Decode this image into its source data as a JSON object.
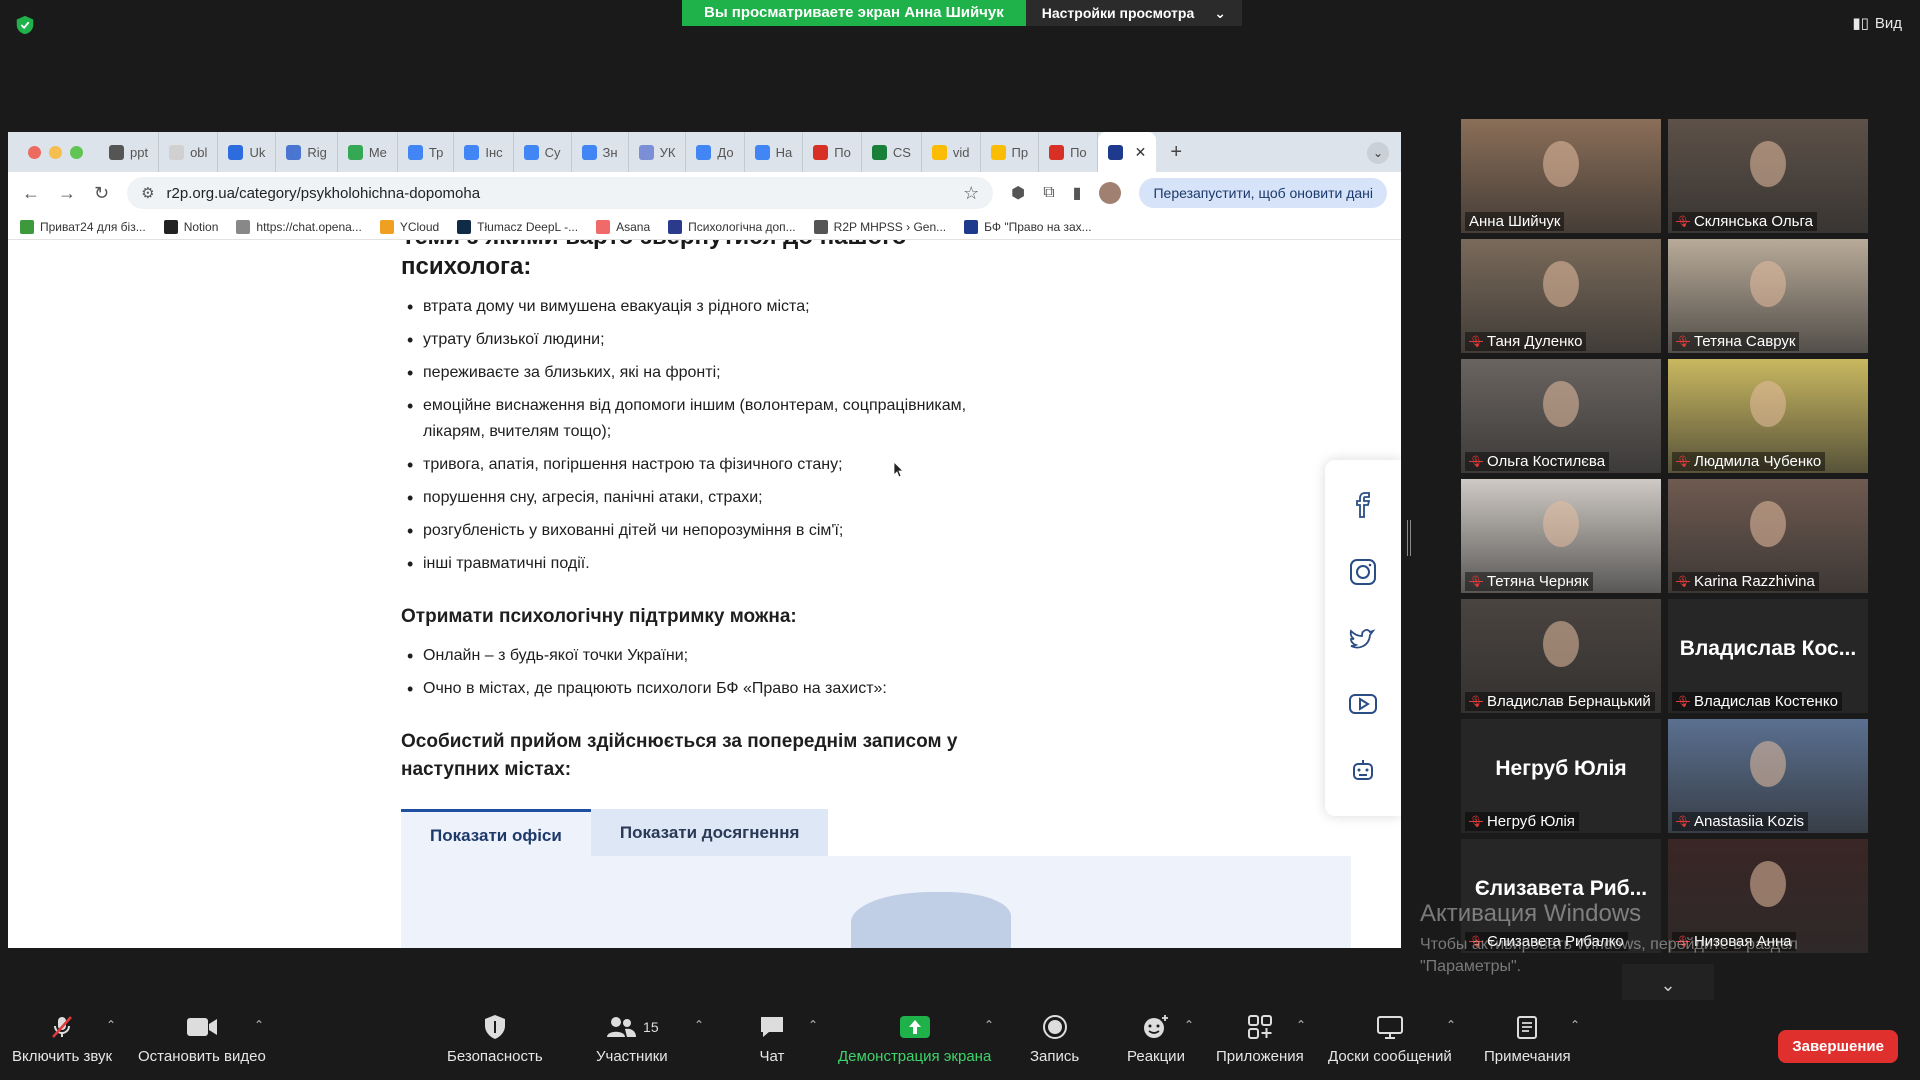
{
  "topbar": {
    "banner_text": "Вы просматриваете экран Анна Шийчук",
    "settings_label": "Настройки просмотра",
    "view_label": "Вид"
  },
  "browser": {
    "tabs": [
      {
        "label": "ppt",
        "color": "#555555"
      },
      {
        "label": "obl",
        "color": "#d0d0d0"
      },
      {
        "label": "Uk",
        "color": "#2d6cdf"
      },
      {
        "label": "Rig",
        "color": "#4a76d1"
      },
      {
        "label": "Me",
        "color": "#34a853"
      },
      {
        "label": "Тр",
        "color": "#4285f4"
      },
      {
        "label": "Інс",
        "color": "#4285f4"
      },
      {
        "label": "Су",
        "color": "#4285f4"
      },
      {
        "label": "Зн",
        "color": "#4285f4"
      },
      {
        "label": "УК",
        "color": "#7a8fd6"
      },
      {
        "label": "До",
        "color": "#4285f4"
      },
      {
        "label": "На",
        "color": "#4285f4"
      },
      {
        "label": "По",
        "color": "#d93025"
      },
      {
        "label": "CS",
        "color": "#188038"
      },
      {
        "label": "vid",
        "color": "#fbbc04"
      },
      {
        "label": "Пр",
        "color": "#fbbc04"
      },
      {
        "label": "По",
        "color": "#d93025"
      }
    ],
    "url": "r2p.org.ua/category/psykholohichna-dopomoha",
    "relaunch": "Перезапустити, щоб оновити дані",
    "bookmarks": [
      {
        "label": "Приват24 для біз...",
        "color": "#3c9a3c"
      },
      {
        "label": "Notion",
        "color": "#222222"
      },
      {
        "label": "https://chat.opena...",
        "color": "#888888"
      },
      {
        "label": "YCloud",
        "color": "#f0a020"
      },
      {
        "label": "Tłumacz DeepL -...",
        "color": "#0f2b46"
      },
      {
        "label": "Asana",
        "color": "#f06a6a"
      },
      {
        "label": "Психологічна доп...",
        "color": "#2b3a8c"
      },
      {
        "label": "R2P MHPSS › Gen...",
        "color": "#555555"
      },
      {
        "label": "БФ \"Право на зах...",
        "color": "#1e3a8c"
      }
    ]
  },
  "page": {
    "heading": "Теми з якими варто звернутися до нашого психолога:",
    "topics": [
      "втрата дому чи вимушена евакуація з рідного міста;",
      "утрату близької людини;",
      "переживаєте за близьких, які на фронті;",
      "емоційне виснаження від допомоги іншим (волонтерам, соцпрацівникам, лікарям, вчителям тощо);",
      "тривога, апатія, погіршення настрою та фізичного стану;",
      "порушення сну, агресія, панічні атаки, страхи;",
      "розгубленість у вихованні дітей чи непорозуміння в сім'ї;",
      "інші травматичні події."
    ],
    "support_heading": "Отримати психологічну підтримку можна:",
    "support": [
      "Онлайн – з будь-якої точки України;",
      "Очно в містах, де працюють психологи БФ «Право на захист»:"
    ],
    "appointment_heading": "Особистий прийом здійснюється за попереднім записом у наступних містах:",
    "tab_offices": "Показати офіси",
    "tab_achievements": "Показати досягнення"
  },
  "participants": [
    {
      "name": "Анна Шийчук",
      "muted": false,
      "speaking": true,
      "photo": "#8a6e58"
    },
    {
      "name": "Склянська Ольга",
      "muted": true,
      "photo": "#5d5148"
    },
    {
      "name": "Таня Дуленко",
      "muted": true,
      "photo": "#7a6a5a"
    },
    {
      "name": "Тетяна Саврук",
      "muted": true,
      "photo": "#b8aa98"
    },
    {
      "name": "Ольга Костилєва",
      "muted": true,
      "photo": "#6a6460"
    },
    {
      "name": "Людмила Чубенко",
      "muted": true,
      "photo": "#c9b860"
    },
    {
      "name": "Тетяна Черняк",
      "muted": true,
      "photo": "#cfcac4"
    },
    {
      "name": "Karina Razzhivina",
      "muted": true,
      "photo": "#6e5a50"
    },
    {
      "name": "Владислав Бернацький",
      "muted": true,
      "photo": "#4a4440"
    },
    {
      "name": "Владислав Костенко",
      "muted": true,
      "big": "Владислав  Кос..."
    },
    {
      "name": "Негруб Юлія",
      "muted": true,
      "big": "Негруб Юлія"
    },
    {
      "name": "Anastasiia Kozis",
      "muted": true,
      "photo": "#5a7090"
    },
    {
      "name": "Єлизавета Рибалко",
      "muted": true,
      "big": "Єлизавета  Риб..."
    },
    {
      "name": "Низовая Анна",
      "muted": true,
      "photo": "#3a2626"
    }
  ],
  "activation": {
    "title": "Активация Windows",
    "line1": "Чтобы активировать Windows, перейдите в раздел",
    "line2": "\"Параметры\"."
  },
  "zoombar": {
    "unmute": "Включить звук",
    "stop_video": "Остановить видео",
    "security": "Безопасность",
    "participants": "Участники",
    "participants_count": "15",
    "chat": "Чат",
    "share": "Демонстрация экрана",
    "record": "Запись",
    "reactions": "Реакции",
    "apps": "Приложения",
    "whiteboards": "Доски сообщений",
    "notes": "Примечания",
    "end": "Завершение"
  }
}
